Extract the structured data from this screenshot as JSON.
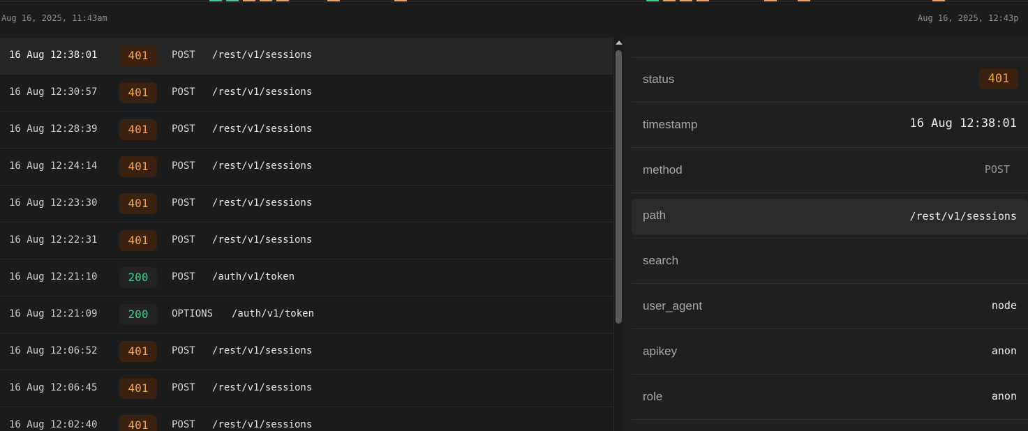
{
  "colors": {
    "error": "#f1a552",
    "success": "#3ecf8e",
    "background": "#1c1c1c"
  },
  "timeline": {
    "start_label": "Aug 16, 2025, 11:43am",
    "end_label": "Aug 16, 2025, 12:43p"
  },
  "logs": [
    {
      "timestamp": "16 Aug 12:38:01",
      "status": "401",
      "method": "POST",
      "path": "/rest/v1/sessions"
    },
    {
      "timestamp": "16 Aug 12:30:57",
      "status": "401",
      "method": "POST",
      "path": "/rest/v1/sessions"
    },
    {
      "timestamp": "16 Aug 12:28:39",
      "status": "401",
      "method": "POST",
      "path": "/rest/v1/sessions"
    },
    {
      "timestamp": "16 Aug 12:24:14",
      "status": "401",
      "method": "POST",
      "path": "/rest/v1/sessions"
    },
    {
      "timestamp": "16 Aug 12:23:30",
      "status": "401",
      "method": "POST",
      "path": "/rest/v1/sessions"
    },
    {
      "timestamp": "16 Aug 12:22:31",
      "status": "401",
      "method": "POST",
      "path": "/rest/v1/sessions"
    },
    {
      "timestamp": "16 Aug 12:21:10",
      "status": "200",
      "method": "POST",
      "path": "/auth/v1/token"
    },
    {
      "timestamp": "16 Aug 12:21:09",
      "status": "200",
      "method": "OPTIONS",
      "path": "/auth/v1/token"
    },
    {
      "timestamp": "16 Aug 12:06:52",
      "status": "401",
      "method": "POST",
      "path": "/rest/v1/sessions"
    },
    {
      "timestamp": "16 Aug 12:06:45",
      "status": "401",
      "method": "POST",
      "path": "/rest/v1/sessions"
    },
    {
      "timestamp": "16 Aug 12:02:40",
      "status": "401",
      "method": "POST",
      "path": "/rest/v1/sessions"
    }
  ],
  "detail": {
    "status_key": "status",
    "status_value": "401",
    "timestamp_key": "timestamp",
    "timestamp_value": "16 Aug 12:38:01",
    "method_key": "method",
    "method_value": "POST",
    "path_key": "path",
    "path_value": "/rest/v1/sessions",
    "search_key": "search",
    "search_value": "",
    "user_agent_key": "user_agent",
    "user_agent_value": "node",
    "apikey_key": "apikey",
    "apikey_value": "anon",
    "role_key": "role",
    "role_value": "anon"
  }
}
